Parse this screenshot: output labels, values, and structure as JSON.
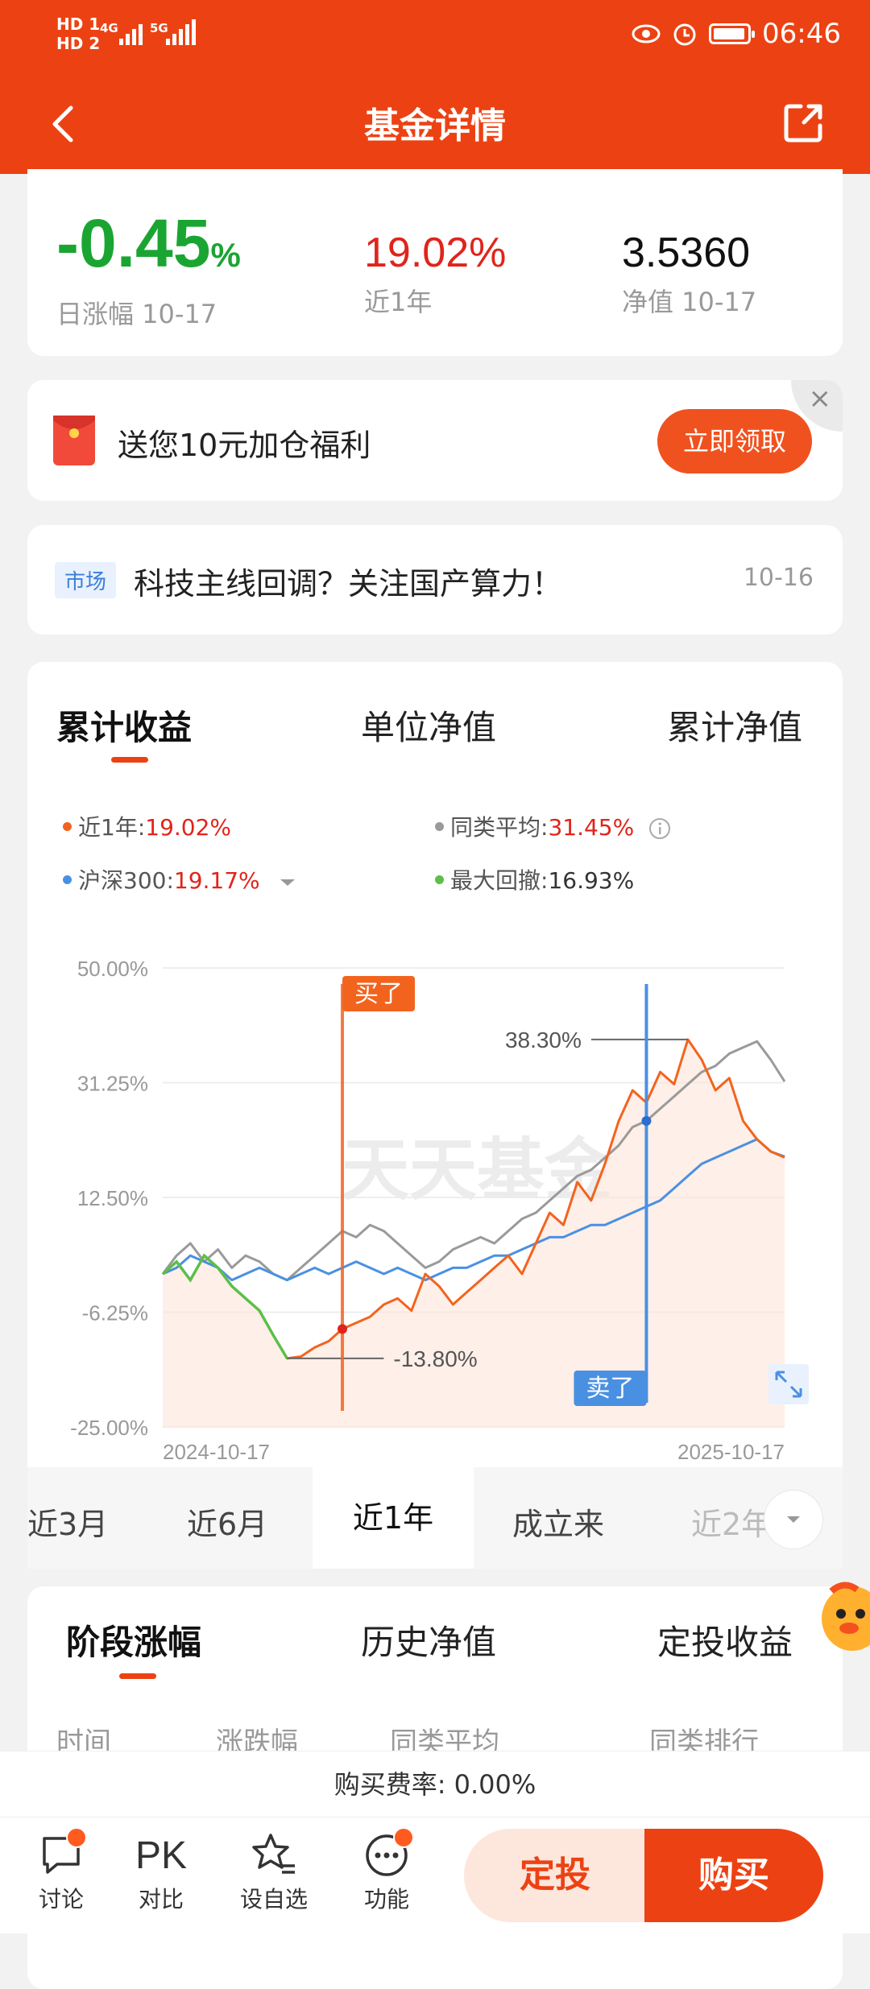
{
  "status_bar": {
    "hd1": "HD 1",
    "hd2": "HD 2",
    "net1": "4G",
    "net2": "5G",
    "time": "06:46"
  },
  "nav": {
    "title": "基金详情"
  },
  "stats": {
    "daily_change": "-0.45",
    "daily_change_unit": "%",
    "daily_label": "日涨幅 10-17",
    "year_return": "19.02%",
    "year_label": "近1年",
    "nav_value": "3.5360",
    "nav_label": "净值 10-17"
  },
  "promo": {
    "text": "送您10元加仓福利",
    "button": "立即领取",
    "close": "×"
  },
  "news": {
    "tag": "市场",
    "headline": "科技主线回调？关注国产算力！",
    "date": "10-16"
  },
  "chart_tabs": [
    "累计收益",
    "单位净值",
    "累计净值"
  ],
  "legend": {
    "fund_label": "近1年:",
    "fund_value": "19.02%",
    "peer_label": "同类平均:",
    "peer_value": "31.45%",
    "index_label": "沪深300:",
    "index_value": "19.17%",
    "drawdown_label": "最大回撤:",
    "drawdown_value": "16.93%"
  },
  "colors": {
    "brand": "#ec4213",
    "fund_line": "#f2641e",
    "peer_line": "#9a9a9a",
    "index_line": "#4a90e2",
    "drawdown_line": "#5cbf4a",
    "up": "#e0241b",
    "down": "#1aa532"
  },
  "chart_data": {
    "type": "line",
    "x_range": [
      "2024-10-17",
      "2025-10-17"
    ],
    "ylim": [
      -25,
      50
    ],
    "y_ticks": [
      "50.00%",
      "31.25%",
      "12.50%",
      "-6.25%",
      "-25.00%"
    ],
    "x_tick_labels": [
      "2024-10-17",
      "2025-10-17"
    ],
    "watermark": "天天基金",
    "annotations": {
      "buy_label": "买了",
      "sell_label": "卖了",
      "peak_label": "38.30%",
      "trough_label": "-13.80%"
    },
    "series": [
      {
        "name": "近1年",
        "values": [
          0,
          2,
          -1,
          3,
          1,
          -2,
          -4,
          -6,
          -10,
          -13.8,
          -13.5,
          -12,
          -11,
          -9,
          -8,
          -7,
          -5,
          -4,
          -6,
          0,
          -2,
          -5,
          -3,
          -1,
          1,
          3,
          0,
          5,
          10,
          8,
          15,
          12,
          18,
          25,
          30,
          28,
          33,
          31,
          38.3,
          35,
          30,
          32,
          25,
          22,
          20,
          19.02
        ]
      },
      {
        "name": "同类平均",
        "values": [
          0,
          3,
          5,
          2,
          4,
          1,
          3,
          2,
          0,
          -1,
          1,
          3,
          5,
          7,
          6,
          8,
          7,
          5,
          3,
          1,
          2,
          4,
          5,
          6,
          5,
          7,
          9,
          10,
          12,
          14,
          16,
          17,
          19,
          21,
          24,
          25,
          27,
          29,
          31,
          33,
          34,
          36,
          37,
          38,
          35,
          31.45
        ]
      },
      {
        "name": "沪深300",
        "values": [
          0,
          1,
          3,
          2,
          1,
          -1,
          0,
          1,
          0,
          -1,
          0,
          1,
          0,
          1,
          2,
          1,
          0,
          1,
          0,
          -1,
          0,
          1,
          1,
          2,
          3,
          3,
          4,
          5,
          6,
          6,
          7,
          8,
          8,
          9,
          10,
          11,
          12,
          14,
          16,
          18,
          19,
          20,
          21,
          22,
          20,
          19.17
        ]
      }
    ]
  },
  "periods": [
    "近3月",
    "近6月",
    "近1年",
    "成立来",
    "近2年"
  ],
  "stage_tabs": [
    "阶段涨幅",
    "历史净值",
    "定投收益"
  ],
  "stage_columns": [
    "时间",
    "涨跌幅",
    "同类平均",
    "同类排行"
  ],
  "fee": "购买费率: 0.00%",
  "bottom_nav": {
    "discuss": "讨论",
    "pk_icon": "PK",
    "pk": "对比",
    "watch": "设自选",
    "func": "功能",
    "dingtou": "定投",
    "buy": "购买"
  }
}
